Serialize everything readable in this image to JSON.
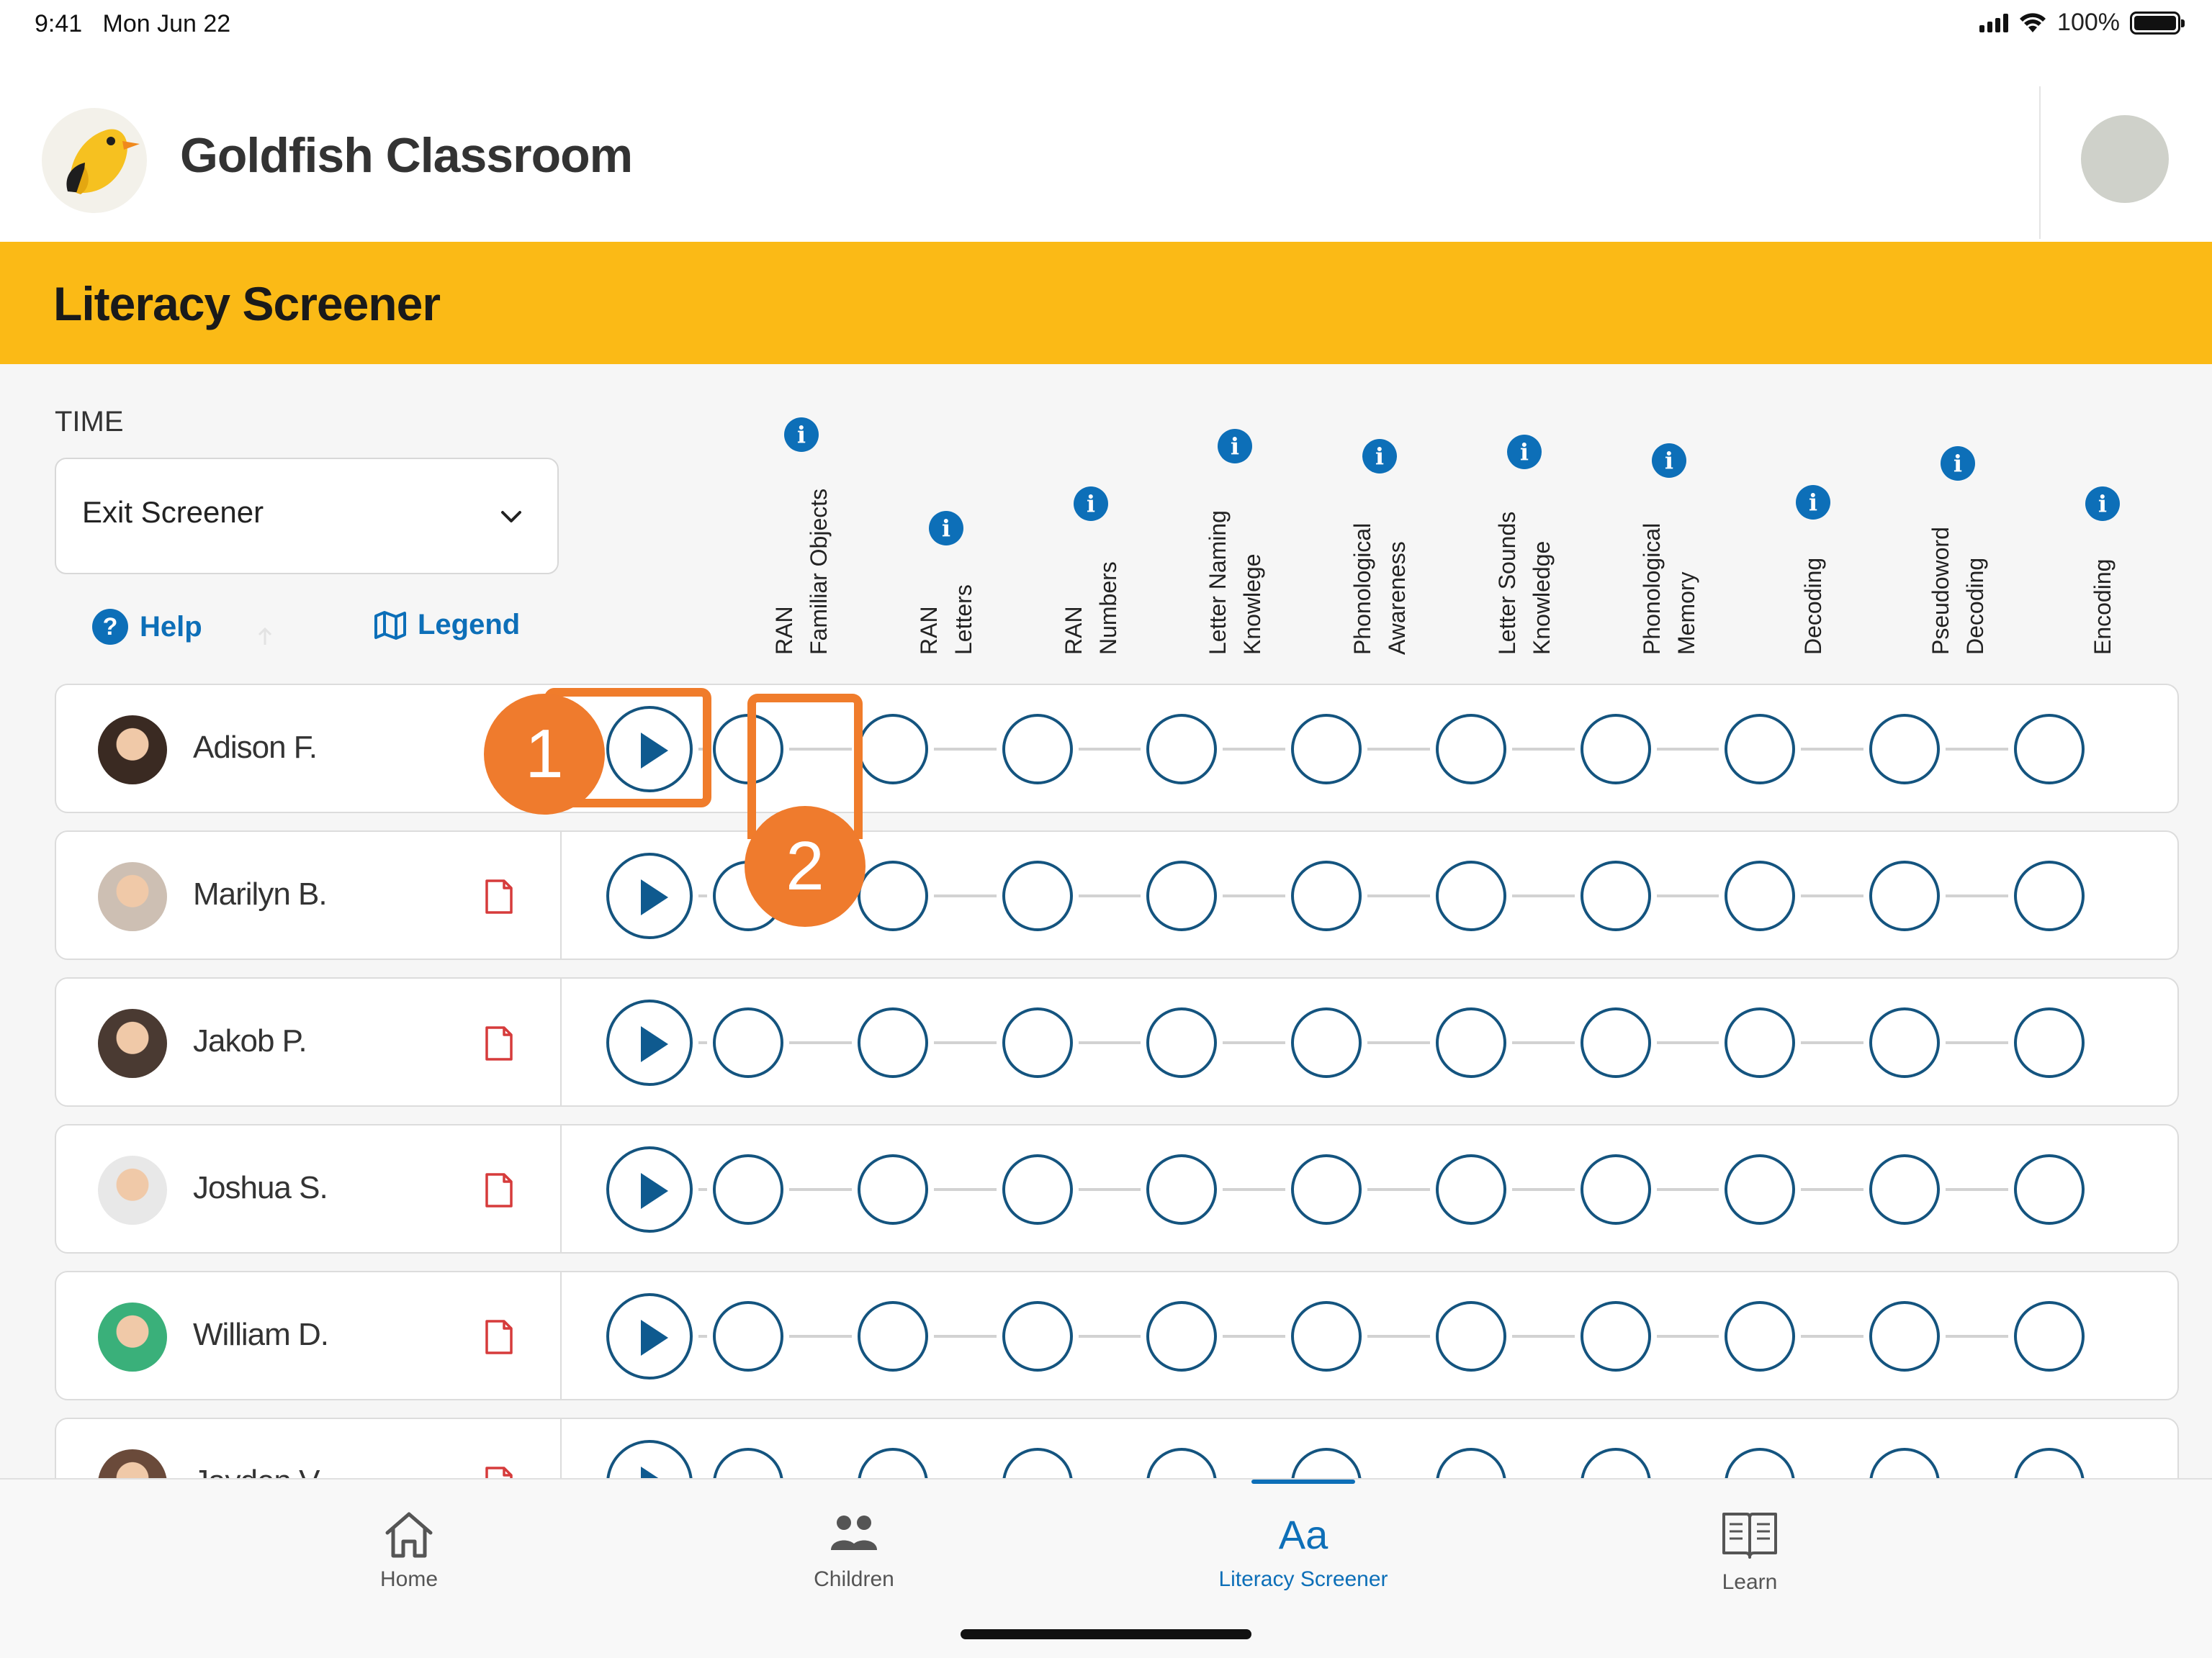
{
  "status_bar": {
    "time": "9:41",
    "date": "Mon Jun 22",
    "battery": "100%",
    "signal_icon": "cellular-signal-icon",
    "wifi_icon": "wifi-icon",
    "battery_icon": "battery-icon"
  },
  "app": {
    "name": "Goldfish Classroom",
    "logo": "bird-logo",
    "profile": "profile-avatar"
  },
  "banner": {
    "title": "Literacy Screener",
    "color": "#fbba16"
  },
  "controls": {
    "time_label": "TIME",
    "dropdown_value": "Exit Screener",
    "help_label": "Help",
    "legend_label": "Legend"
  },
  "columns": [
    {
      "line1": "RAN",
      "line2": "Familiar Objects"
    },
    {
      "line1": "RAN",
      "line2": "Letters"
    },
    {
      "line1": "RAN",
      "line2": "Numbers"
    },
    {
      "line1": "Letter Naming",
      "line2": "Knowlege"
    },
    {
      "line1": "Phonological",
      "line2": "Awareness"
    },
    {
      "line1": "Letter Sounds",
      "line2": "Knowledge"
    },
    {
      "line1": "Phonological",
      "line2": "Memory"
    },
    {
      "line1": "Decoding",
      "line2": ""
    },
    {
      "line1": "Pseudoword",
      "line2": "Decoding"
    },
    {
      "line1": "Encoding",
      "line2": ""
    }
  ],
  "students": [
    {
      "name": "Adison F.",
      "avatar_color": "#3a2a22"
    },
    {
      "name": "Marilyn B.",
      "avatar_color": "#cdbfb3"
    },
    {
      "name": "Jakob P.",
      "avatar_color": "#4a3a32"
    },
    {
      "name": "Joshua S.",
      "avatar_color": "#e8e8e8"
    },
    {
      "name": "William D.",
      "avatar_color": "#3ab07a"
    },
    {
      "name": "Jayden V.",
      "avatar_color": "#6a4a3a"
    }
  ],
  "callouts": [
    "1",
    "2"
  ],
  "tabs": [
    {
      "label": "Home",
      "icon": "home-icon"
    },
    {
      "label": "Children",
      "icon": "children-icon"
    },
    {
      "label": "Literacy Screener",
      "icon": "literacy-screener-icon"
    },
    {
      "label": "Learn",
      "icon": "book-icon"
    }
  ],
  "colors": {
    "accent": "#0d6fb8",
    "callout": "#f07c2b",
    "step_border": "#14547f",
    "doc_icon": "#d63b3b"
  }
}
